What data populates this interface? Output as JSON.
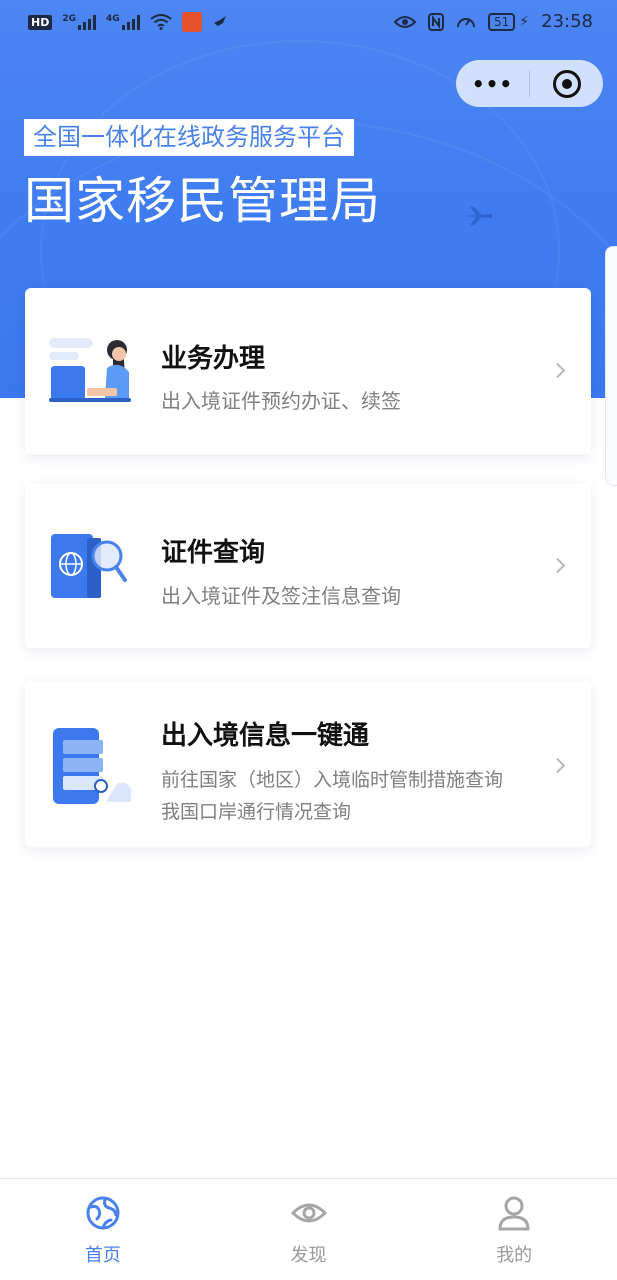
{
  "status_bar": {
    "hd_label": "HD",
    "network_2g": "2G",
    "network_4g": "4G",
    "battery": "51",
    "time": "23:58"
  },
  "header": {
    "subtitle": "全国一体化在线政务服务平台",
    "title": "国家移民管理局"
  },
  "capsule": {
    "more_label": "•••"
  },
  "cards": [
    {
      "title": "业务办理",
      "desc": [
        "出入境证件预约办证、续签"
      ]
    },
    {
      "title": "证件查询",
      "desc": [
        "出入境证件及签注信息查询"
      ]
    },
    {
      "title": "出入境信息一键通",
      "desc": [
        "前往国家（地区）入境临时管制措施查询",
        "我国口岸通行情况查询"
      ]
    }
  ],
  "tabbar": {
    "items": [
      {
        "label": "首页",
        "icon": "globe-icon",
        "active": true
      },
      {
        "label": "发现",
        "icon": "eye-icon",
        "active": false
      },
      {
        "label": "我的",
        "icon": "user-icon",
        "active": false
      }
    ]
  },
  "colors": {
    "brand_blue": "#4a82ec",
    "header_bg": "#3f7cf0",
    "text_primary": "#111111",
    "text_secondary": "#808080"
  }
}
